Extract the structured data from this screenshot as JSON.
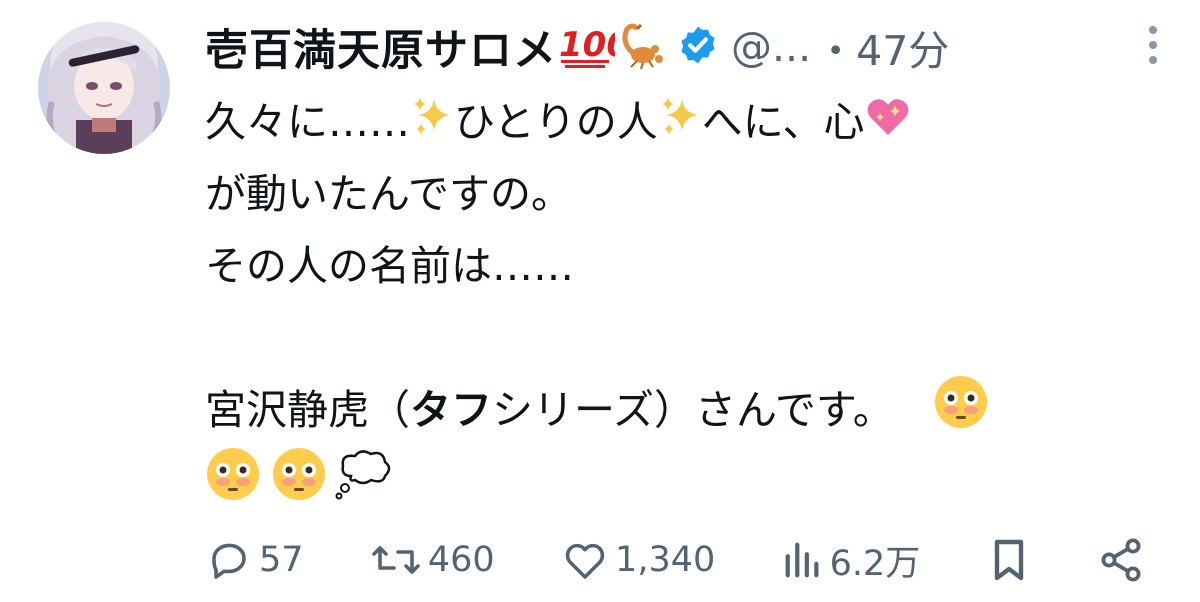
{
  "tweet": {
    "display_name": "壱百満天原サロメ",
    "name_emojis": [
      "hundred-points-emoji",
      "scorpion-emoji"
    ],
    "verified": true,
    "handle": "@...",
    "separator": "・",
    "time": "47分",
    "body": {
      "line1_a": "久々に……",
      "line1_b": "ひとりの人",
      "line1_c": "へに、心",
      "line2": "が動いたんですの。",
      "line3": "その人の名前は……",
      "line5_a": "宮沢静虎（",
      "line5_bold": "タフ",
      "line5_b": "シリーズ）さんです。"
    },
    "body_emojis": [
      "sparkles-emoji",
      "sparkles-emoji",
      "sparkling-heart-emoji",
      "flushed-face-emoji",
      "flushed-face-emoji",
      "flushed-face-emoji",
      "thought-balloon-emoji"
    ]
  },
  "actions": {
    "replies": "57",
    "retweets": "460",
    "likes": "1,340",
    "views": "6.2万"
  },
  "colors": {
    "text": "#0f1419",
    "secondary": "#536471",
    "verified": "#1d9bf0"
  }
}
